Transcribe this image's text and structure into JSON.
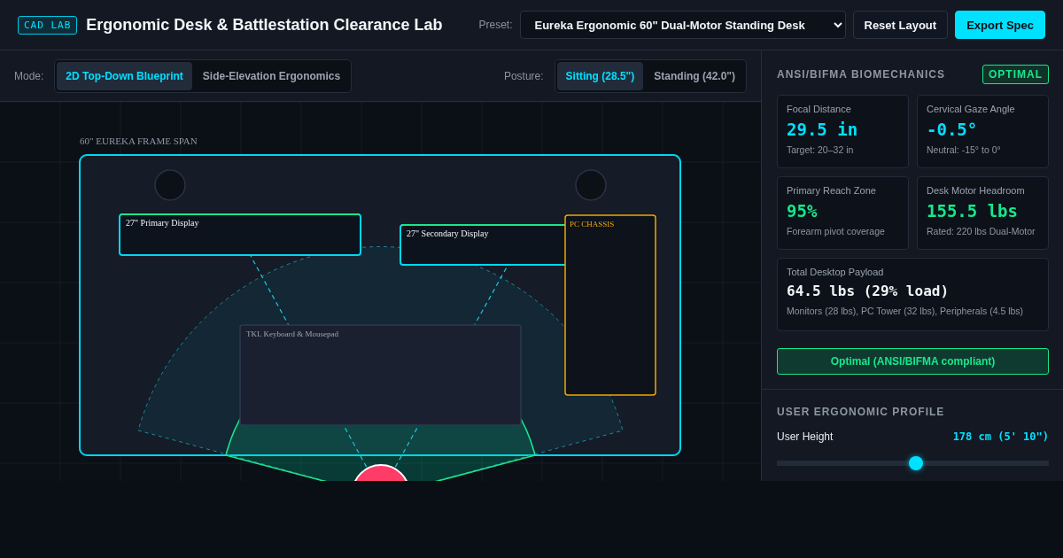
{
  "header": {
    "logo": "CAD LAB",
    "title": "Ergonomic Desk & Battlestation Clearance Lab",
    "preset_label": "Preset:",
    "preset_value": "Eureka Ergonomic 60\" Dual-Motor Standing Desk",
    "buttons": [
      {
        "label": "Reset Layout",
        "kind": "secondary"
      },
      {
        "label": "Export Spec",
        "kind": "primary"
      }
    ]
  },
  "toolbar": {
    "mode_label": "Mode:",
    "modes": [
      {
        "label": "2D Top-Down Blueprint",
        "selected": true
      },
      {
        "label": "Side-Elevation Ergonomics",
        "selected": false
      }
    ],
    "posture_label": "Posture:",
    "postures": [
      {
        "label": "Sitting (28.5\")",
        "selected": true
      },
      {
        "label": "Standing (42.0\")",
        "selected": false
      }
    ]
  },
  "blueprint": {
    "frame_label": "60\" EUREKA FRAME SPAN",
    "items": [
      {
        "kind": "display",
        "label": "27\" Primary Display"
      },
      {
        "kind": "display",
        "label": "27\" Secondary Display"
      },
      {
        "kind": "keyboard",
        "label": "TKL Keyboard & Mousepad"
      },
      {
        "kind": "tower",
        "label": "PC CHASSIS"
      }
    ]
  },
  "biomechanics": {
    "title": "ANSI/BIFMA BIOMECHANICS",
    "badge": "OPTIMAL",
    "metrics": [
      {
        "label": "Focal Distance",
        "value": "29.5 in",
        "note": "Target: 20–32 in",
        "color": "#00e0ff"
      },
      {
        "label": "Cervical Gaze Angle",
        "value": "-0.5°",
        "note": "Neutral: -15° to 0°",
        "color": "#00e0ff"
      },
      {
        "label": "Primary Reach Zone",
        "value": "95%",
        "note": "Forearm pivot coverage",
        "color": "#19e68c"
      },
      {
        "label": "Desk Motor Headroom",
        "value": "155.5 lbs",
        "note": "Rated: 220 lbs Dual-Motor",
        "color": "#19e68c"
      },
      {
        "label": "Total Desktop Payload",
        "value": "64.5 lbs (29% load)",
        "note": "Monitors (28 lbs), PC Tower (32 lbs), Peripherals (4.5 lbs)",
        "color": "#f2f4f7"
      }
    ],
    "status": "Optimal (ANSI/BIFMA compliant)"
  },
  "profile": {
    "title": "USER ERGONOMIC PROFILE",
    "sliders": [
      {
        "label": "User Height",
        "reading": "178 cm (5' 10\")",
        "level": 0.51
      }
    ]
  }
}
